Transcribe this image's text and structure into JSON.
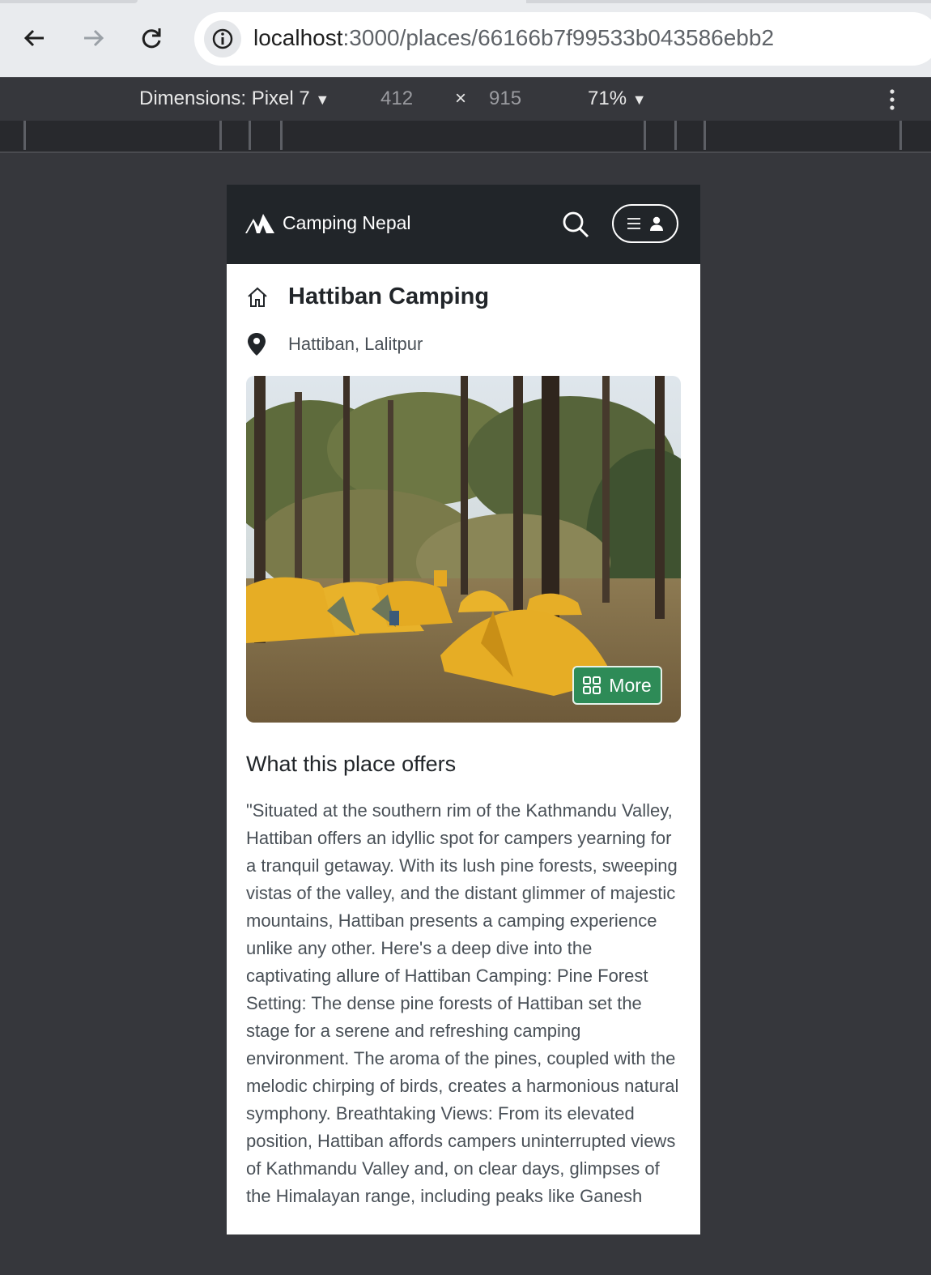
{
  "browser": {
    "url_host": "localhost",
    "url_path": ":3000/places/66166b7f99533b043586ebb2"
  },
  "devtools": {
    "device_label": "Dimensions: Pixel 7",
    "width": "412",
    "times": "×",
    "height": "915",
    "zoom": "71%"
  },
  "navbar": {
    "brand": "Camping Nepal"
  },
  "place": {
    "title": "Hattiban Camping",
    "location": "Hattiban, Lalitpur",
    "more_label": "More",
    "offers_heading": "What this place offers",
    "description": "\"Situated at the southern rim of the Kathmandu Valley, Hattiban offers an idyllic spot for campers yearning for a tranquil getaway. With its lush pine forests, sweeping vistas of the valley, and the distant glimmer of majestic mountains, Hattiban presents a camping experience unlike any other. Here's a deep dive into the captivating allure of Hattiban Camping: Pine Forest Setting: The dense pine forests of Hattiban set the stage for a serene and refreshing camping environment. The aroma of the pines, coupled with the melodic chirping of birds, creates a harmonious natural symphony. Breathtaking Views: From its elevated position, Hattiban affords campers uninterrupted views of Kathmandu Valley and, on clear days, glimpses of the Himalayan range, including peaks like Ganesh"
  },
  "colors": {
    "navbar_bg": "#212529",
    "more_button_bg": "#2e8b57",
    "devtools_bg": "#36373c"
  }
}
